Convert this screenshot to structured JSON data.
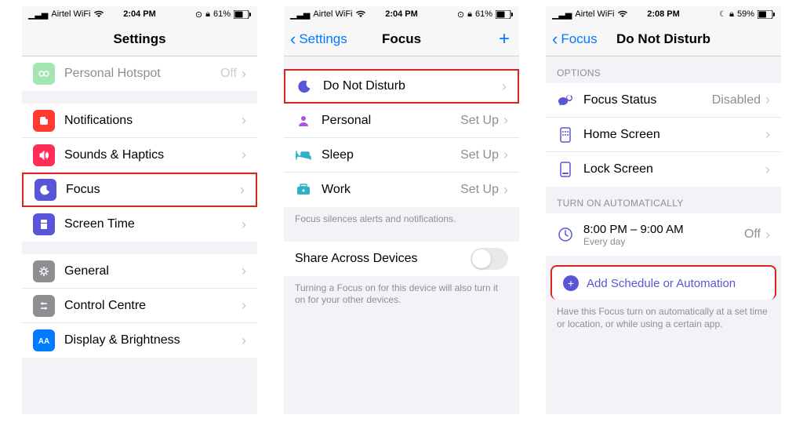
{
  "screen1": {
    "status": {
      "carrier": "Airtel WiFi",
      "time": "2:04 PM",
      "battery": "61%"
    },
    "title": "Settings",
    "rows": {
      "hotspot": {
        "label": "Personal Hotspot",
        "detail": "Off"
      },
      "notifications": {
        "label": "Notifications"
      },
      "sounds": {
        "label": "Sounds & Haptics"
      },
      "focus": {
        "label": "Focus"
      },
      "screentime": {
        "label": "Screen Time"
      },
      "general": {
        "label": "General"
      },
      "control": {
        "label": "Control Centre"
      },
      "display": {
        "label": "Display & Brightness"
      }
    }
  },
  "screen2": {
    "status": {
      "carrier": "Airtel WiFi",
      "time": "2:04 PM",
      "battery": "61%"
    },
    "back": "Settings",
    "title": "Focus",
    "rows": {
      "dnd": {
        "label": "Do Not Disturb"
      },
      "personal": {
        "label": "Personal",
        "detail": "Set Up"
      },
      "sleep": {
        "label": "Sleep",
        "detail": "Set Up"
      },
      "work": {
        "label": "Work",
        "detail": "Set Up"
      }
    },
    "footer1": "Focus silences alerts and notifications.",
    "share": {
      "label": "Share Across Devices"
    },
    "footer2": "Turning a Focus on for this device will also turn it on for your other devices."
  },
  "screen3": {
    "status": {
      "carrier": "Airtel WiFi",
      "time": "2:08 PM",
      "battery": "59%"
    },
    "back": "Focus",
    "title": "Do Not Disturb",
    "header1": "OPTIONS",
    "rows": {
      "status": {
        "label": "Focus Status",
        "detail": "Disabled"
      },
      "home": {
        "label": "Home Screen"
      },
      "lock": {
        "label": "Lock Screen"
      }
    },
    "header2": "TURN ON AUTOMATICALLY",
    "schedule": {
      "time": "8:00 PM – 9:00 AM",
      "repeat": "Every day",
      "state": "Off"
    },
    "add": {
      "label": "Add Schedule or Automation"
    },
    "footer": "Have this Focus turn on automatically at a set time or location, or while using a certain app."
  }
}
